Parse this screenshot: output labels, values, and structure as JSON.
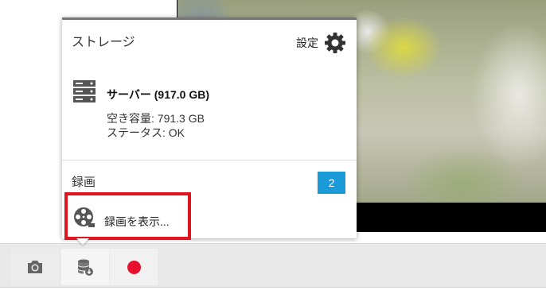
{
  "storage_popover": {
    "title": "ストレージ",
    "settings_label": "設定",
    "server": {
      "name": "サーバー (917.0 GB)",
      "free_space": "空き容量: 791.3 GB",
      "status": "ステータス: OK"
    },
    "recordings": {
      "title": "録画",
      "count": "2",
      "view_label": "録画を表示..."
    }
  },
  "toolbar": {
    "buttons": [
      {
        "icon": "camera-icon"
      },
      {
        "icon": "storage-icon"
      },
      {
        "icon": "record-icon"
      }
    ]
  },
  "colors": {
    "badge": "#1a9ad6",
    "record_dot": "#e8102e",
    "highlight_box": "#e0141e"
  }
}
